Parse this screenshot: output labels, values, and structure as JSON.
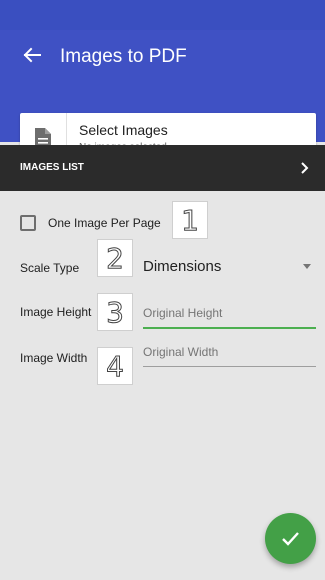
{
  "app_bar": {
    "title": "Images to PDF",
    "color": "#3f51c4"
  },
  "select_card": {
    "title": "Select Images",
    "subtitle": "No images selected",
    "icon": "document-icon"
  },
  "images_list": {
    "label": "IMAGES LIST",
    "icon": "chevron-right-icon"
  },
  "options": {
    "one_per_page_label": "One Image Per Page",
    "one_per_page_checked": false,
    "scale_type_label": "Scale Type",
    "scale_type_value": "Dimensions",
    "image_height_label": "Image Height",
    "image_height_placeholder": "Original Height",
    "image_width_label": "Image Width",
    "image_width_placeholder": "Original Width"
  },
  "annotations": {
    "n1": "1",
    "n2": "2",
    "n3": "3",
    "n4": "4"
  },
  "fab": {
    "icon": "checkmark-icon",
    "color": "#43a047"
  }
}
